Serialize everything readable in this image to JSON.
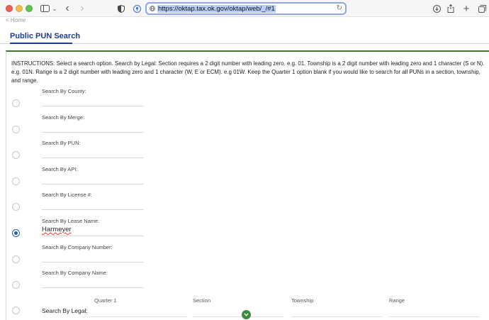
{
  "browser": {
    "url": "https://oktap.tax.ok.gov/oktap/web/_/#1"
  },
  "page": {
    "breadcrumb": "< Home",
    "title": "Public PUN Search",
    "instructions": "INSTRUCTIONS: Select a search option. Search by Legal: Section requires a 2 digit number with leading zero. e.g. 01. Township is a 2 digit number with leading zero and 1 character (S or N). e.g. 01N. Range is a 2 digit number with leading zero and 1 character (W, E or ECM). e.g 01W. Keep the Quarter 1 option blank if you would like to search for all PUNs in a section, township, and range."
  },
  "options": [
    {
      "label": "Search By County:",
      "value": "",
      "selected": false
    },
    {
      "label": "Search By Merge:",
      "value": "",
      "selected": false
    },
    {
      "label": "Search By PUN:",
      "value": "",
      "selected": false
    },
    {
      "label": "Search By API:",
      "value": "",
      "selected": false
    },
    {
      "label": "Search By License #:",
      "value": "",
      "selected": false
    },
    {
      "label": "Search By Lease Name:",
      "value": "Harmeyer",
      "selected": true
    },
    {
      "label": "Search By Company Number:",
      "value": "",
      "selected": false
    },
    {
      "label": "Search By Company Name:",
      "value": "",
      "selected": false
    }
  ],
  "legal": {
    "label": "Search By Legal:",
    "columns": [
      "Quarter 1",
      "Section",
      "Township",
      "Range"
    ]
  }
}
